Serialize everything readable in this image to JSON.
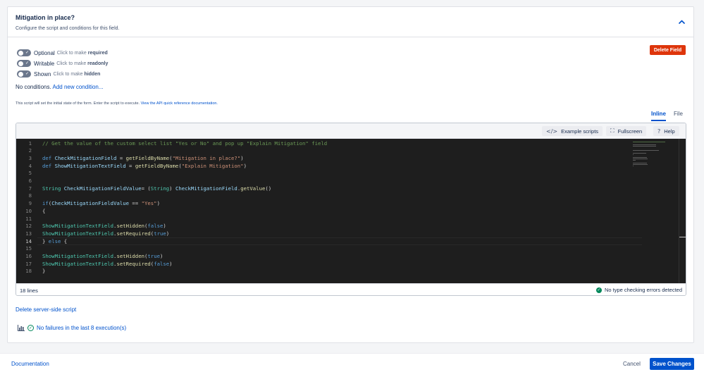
{
  "panel": {
    "title": "Mitigation in place?",
    "description": "Configure the script and conditions for this field."
  },
  "toggles": [
    {
      "label": "Optional",
      "hint_prefix": "Click to make",
      "hint_bold": "required"
    },
    {
      "label": "Writable",
      "hint_prefix": "Click to make",
      "hint_bold": "readonly"
    },
    {
      "label": "Shown",
      "hint_prefix": "Click to make",
      "hint_bold": "hidden"
    }
  ],
  "delete_field_label": "Delete Field",
  "conditions": {
    "text": "No conditions.",
    "link": "Add new condition..."
  },
  "script_note": {
    "text": "This script will set the initial state of the form. Enter the script to execute.",
    "link": "View the API quick reference documentation."
  },
  "tabs": {
    "inline": "Inline",
    "file": "File"
  },
  "toolbar": {
    "example_scripts": "Example scripts",
    "fullscreen": "Fullscreen",
    "help": "Help"
  },
  "code_lines": [
    [
      [
        "c-com",
        "// Get the value of the custom select list \"Yes or No\" and pop up \"Explain Mitigation\" field"
      ]
    ],
    [],
    [
      [
        "c-kw",
        "def "
      ],
      [
        "c-var",
        "CheckMitigationField"
      ],
      [
        "c-plain",
        " = "
      ],
      [
        "c-fn",
        "getFieldByName"
      ],
      [
        "c-plain",
        "("
      ],
      [
        "c-str",
        "\"Mitigation in place?\""
      ],
      [
        "c-plain",
        ")"
      ]
    ],
    [
      [
        "c-kw",
        "def "
      ],
      [
        "c-var",
        "ShowMitigationTextField"
      ],
      [
        "c-plain",
        " = "
      ],
      [
        "c-fn",
        "getFieldByName"
      ],
      [
        "c-plain",
        "("
      ],
      [
        "c-str",
        "\"Explain Mitigation\""
      ],
      [
        "c-plain",
        ")"
      ]
    ],
    [],
    [],
    [
      [
        "c-cls",
        "String "
      ],
      [
        "c-var",
        "CheckMitigationFieldValue"
      ],
      [
        "c-plain",
        "= ("
      ],
      [
        "c-cls",
        "String"
      ],
      [
        "c-plain",
        ") "
      ],
      [
        "c-var",
        "CheckMitigationField"
      ],
      [
        "c-plain",
        "."
      ],
      [
        "c-fn",
        "getValue"
      ],
      [
        "c-plain",
        "()"
      ]
    ],
    [],
    [
      [
        "c-kw",
        "if"
      ],
      [
        "c-plain",
        "("
      ],
      [
        "c-var",
        "CheckMitigationFieldValue"
      ],
      [
        "c-plain",
        " == "
      ],
      [
        "c-str",
        "\"Yes\""
      ],
      [
        "c-plain",
        ")"
      ]
    ],
    [
      [
        "c-plain",
        "{"
      ]
    ],
    [],
    [
      [
        "c-cls",
        "ShowMitigationTextField"
      ],
      [
        "c-plain",
        "."
      ],
      [
        "c-fn",
        "setHidden"
      ],
      [
        "c-plain",
        "("
      ],
      [
        "c-kw",
        "false"
      ],
      [
        "c-plain",
        ")"
      ]
    ],
    [
      [
        "c-cls",
        "ShowMitigationTextField"
      ],
      [
        "c-plain",
        "."
      ],
      [
        "c-fn",
        "setRequired"
      ],
      [
        "c-plain",
        "("
      ],
      [
        "c-kw",
        "true"
      ],
      [
        "c-plain",
        ")"
      ]
    ],
    [
      [
        "c-plain",
        "} "
      ],
      [
        "c-kw",
        "else"
      ],
      [
        "c-plain",
        " {"
      ]
    ],
    [],
    [
      [
        "c-cls",
        "ShowMitigationTextField"
      ],
      [
        "c-plain",
        "."
      ],
      [
        "c-fn",
        "setHidden"
      ],
      [
        "c-plain",
        "("
      ],
      [
        "c-kw",
        "true"
      ],
      [
        "c-plain",
        ")"
      ]
    ],
    [
      [
        "c-cls",
        "ShowMitigationTextField"
      ],
      [
        "c-plain",
        "."
      ],
      [
        "c-fn",
        "setRequired"
      ],
      [
        "c-plain",
        "("
      ],
      [
        "c-kw",
        "false"
      ],
      [
        "c-plain",
        ")"
      ]
    ],
    [
      [
        "c-plain",
        "}"
      ]
    ]
  ],
  "active_line": 14,
  "editor_footer": {
    "lines_count": "18 lines",
    "type_check": "No type checking errors detected"
  },
  "delete_script_label": "Delete server-side script",
  "executions_label": "No failures in the last 8 execution(s)",
  "bottom": {
    "documentation": "Documentation",
    "cancel": "Cancel",
    "save": "Save Changes"
  },
  "colors": {
    "accent": "#0052cc",
    "danger": "#de350b",
    "success": "#00875a",
    "editor_bg": "#1e1e1e"
  }
}
